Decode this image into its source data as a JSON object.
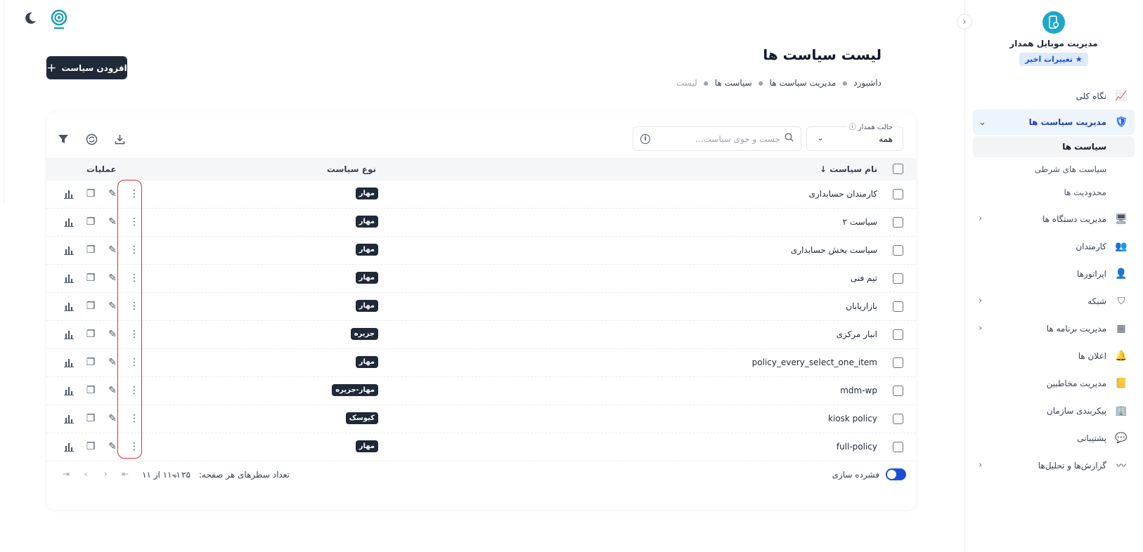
{
  "sidebar": {
    "brand_title": "مدیریت موبایل همدار",
    "recent_changes": "تغییرات اخیر",
    "items": [
      {
        "label": "نگاه کلی"
      },
      {
        "label": "مدیریت سیاست ها",
        "sub": [
          {
            "label": "سیاست ها"
          },
          {
            "label": "سیاست های شرطی"
          },
          {
            "label": "محدودیت ها"
          }
        ]
      },
      {
        "label": "مدیریت دستگاه ها"
      },
      {
        "label": "کارمندان"
      },
      {
        "label": "اپراتورها"
      },
      {
        "label": "شبکه"
      },
      {
        "label": "مدیریت برنامه ها"
      },
      {
        "label": "اعلان ها"
      },
      {
        "label": "مدیریت مخاطبین"
      },
      {
        "label": "پیکربندی سازمان"
      },
      {
        "label": "پشتیبانی"
      },
      {
        "label": "گزارش‌ها و تحلیل‌ها"
      }
    ]
  },
  "header": {
    "title": "لیست سیاست ها",
    "breadcrumb": [
      "داشبورد",
      "مدیریت سیاست ها",
      "سیاست ها",
      "لیست"
    ],
    "add_button": "افزودن سیاست"
  },
  "filters": {
    "device_state_label": "حالت همدار",
    "device_state_value": "همه",
    "search_placeholder": "جست و جوی سیاست..."
  },
  "table": {
    "columns": {
      "name": "نام سیاست",
      "type": "نوع سیاست",
      "ops": "عملیات"
    },
    "rows": [
      {
        "name": "کارمندان حسابداری",
        "type": "مهار"
      },
      {
        "name": "سیاست ۲",
        "type": "مهار"
      },
      {
        "name": "سیاست بخش حسابداری",
        "type": "مهار"
      },
      {
        "name": "تیم فنی",
        "type": "مهار"
      },
      {
        "name": "بازاریابان",
        "type": "مهار"
      },
      {
        "name": "انبار مرکزی",
        "type": "جزیره"
      },
      {
        "name": "policy_every_select_one_item",
        "type": "مهار"
      },
      {
        "name": "mdm-wp",
        "type": "مهار-جزیره"
      },
      {
        "name": "kiosk policy",
        "type": "کیوسک"
      },
      {
        "name": "full-policy",
        "type": "مهار"
      }
    ]
  },
  "footer": {
    "dense_label": "فشرده سازی",
    "rows_per_page_label": "تعداد سطرهای هر صفحه:",
    "rows_per_page_value": "۲۵",
    "page_range": "۱–۱۱ از ۱۱"
  },
  "colors": {
    "accent": "#1d4ed8",
    "badge_bg": "#1f2937",
    "highlight": "#e03131",
    "brand": "#1fa7c9"
  },
  "icons": {
    "stats": "bar-chart-icon",
    "copy": "copy-icon",
    "edit": "pencil-icon",
    "more": "more-vertical-icon"
  }
}
